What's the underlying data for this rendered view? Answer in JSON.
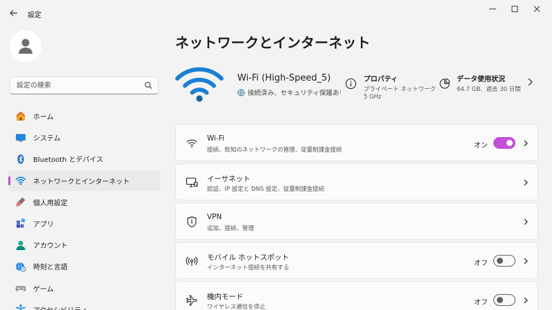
{
  "window": {
    "title": "設定"
  },
  "sidebar": {
    "search_placeholder": "設定の検索",
    "items": [
      {
        "label": "ホーム",
        "icon": "home-icon"
      },
      {
        "label": "システム",
        "icon": "monitor-icon"
      },
      {
        "label": "Bluetooth とデバイス",
        "icon": "bluetooth-icon"
      },
      {
        "label": "ネットワークとインターネット",
        "icon": "wifi-icon",
        "active": true
      },
      {
        "label": "個人用設定",
        "icon": "brush-icon"
      },
      {
        "label": "アプリ",
        "icon": "apps-icon"
      },
      {
        "label": "アカウント",
        "icon": "person-icon"
      },
      {
        "label": "時刻と言語",
        "icon": "globe-clock-icon"
      },
      {
        "label": "ゲーム",
        "icon": "gamepad-icon"
      },
      {
        "label": "アクセシビリティ",
        "icon": "accessibility-icon"
      }
    ]
  },
  "main": {
    "title": "ネットワークとインターネット",
    "hero": {
      "name": "Wi-Fi (High-Speed_5)",
      "status": "接続済み、セキュリティ保護あり",
      "properties": {
        "title": "プロパティ",
        "line1": "プライベート ネットワーク",
        "line2": "5 GHz"
      },
      "data_usage": {
        "title": "データ使用状況",
        "line1": "64.7 GB、過去 30 日間"
      }
    },
    "cards": [
      {
        "title": "Wi-Fi",
        "subtitle": "接続、既知のネットワークの管理、従量制課金接続",
        "toggle": "オン",
        "toggle_on": true,
        "icon": "wifi-icon"
      },
      {
        "title": "イーサネット",
        "subtitle": "認証、IP 設定と DNS 設定、従量制課金接続",
        "icon": "ethernet-icon"
      },
      {
        "title": "VPN",
        "subtitle": "追加、接続、管理",
        "icon": "shield-icon"
      },
      {
        "title": "モバイル ホットスポット",
        "subtitle": "インターネット接続を共有する",
        "toggle": "オフ",
        "toggle_on": false,
        "icon": "hotspot-icon"
      },
      {
        "title": "機内モード",
        "subtitle": "ワイヤレス通信を停止",
        "toggle": "オフ",
        "toggle_on": false,
        "icon": "airplane-icon"
      }
    ]
  },
  "colors": {
    "accent": "#c24fd6",
    "wifi_blue": "#1a7fd4",
    "background": "#f3f3f3",
    "card": "#fbfbfb"
  }
}
